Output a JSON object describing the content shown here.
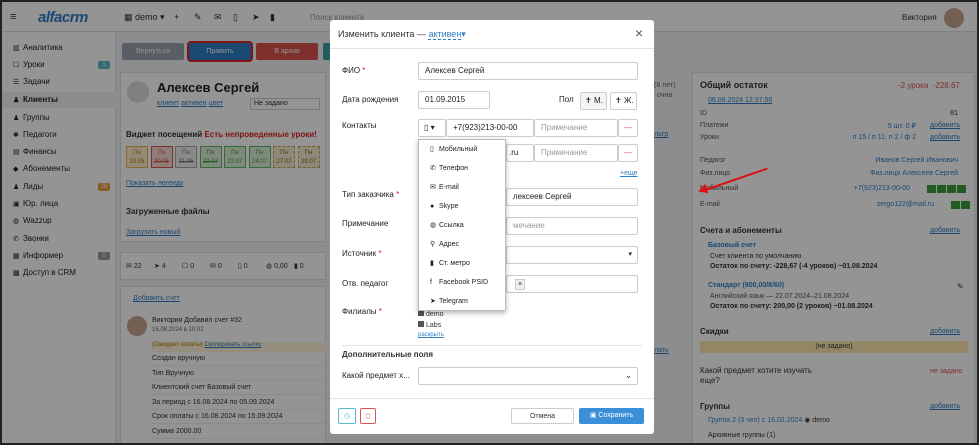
{
  "topbar": {
    "logo": "alfacrm",
    "branch": "demo",
    "search_placeholder": "Поиск клиента",
    "user_name": "Виктория"
  },
  "sidebar": {
    "items": [
      {
        "label": "Аналитика",
        "icon": "chart-icon"
      },
      {
        "label": "Уроки",
        "icon": "calendar-icon",
        "badge": "1"
      },
      {
        "label": "Задачи",
        "icon": "tasks-icon"
      },
      {
        "label": "Клиенты",
        "icon": "user-icon"
      },
      {
        "label": "Группы",
        "icon": "users-icon"
      },
      {
        "label": "Педагоги",
        "icon": "teacher-icon"
      },
      {
        "label": "Финансы",
        "icon": "finance-icon"
      },
      {
        "label": "Абонементы",
        "icon": "tag-icon"
      },
      {
        "label": "Лиды",
        "icon": "lead-icon",
        "badge": "26"
      },
      {
        "label": "Юр. лица",
        "icon": "building-icon"
      },
      {
        "label": "Wazzup",
        "icon": "chat-icon"
      },
      {
        "label": "Звонки",
        "icon": "phone-icon"
      },
      {
        "label": "Информер",
        "icon": "inbox-icon",
        "badge": "0"
      },
      {
        "label": "Доступ в CRM",
        "icon": "lock-icon"
      }
    ]
  },
  "client": {
    "toolbar": {
      "back": "Вернуться",
      "edit": "Править",
      "archive": "В архив"
    },
    "name": "Алексев Сергей",
    "tags": {
      "type": "клиент",
      "status": "активен",
      "color": "цвет",
      "select": "Не задано"
    },
    "widget_title": "Виджет посещений",
    "widget_warning": "Есть непроведенные уроки!",
    "visits": [
      {
        "day": "Пн",
        "date": "20.05"
      },
      {
        "day": "Пн",
        "date": "20.05"
      },
      {
        "day": "Пн",
        "date": "21.05"
      },
      {
        "day": "Пн",
        "date": "22.07"
      },
      {
        "day": "Пн",
        "date": "22.07"
      },
      {
        "day": "Пн",
        "date": "24.07"
      },
      {
        "day": "Пн",
        "date": "27.07"
      },
      {
        "day": "Пн",
        "date": "29.07"
      }
    ],
    "show_legend": "Показать легенду",
    "files_title": "Загруженные файлы",
    "upload": "Загрузить новый",
    "stats": [
      "22",
      "4",
      "0",
      "0",
      "0",
      "0,00",
      "0"
    ],
    "add_invoice": "Добавить счет",
    "feed_author": "Виктория Добавил счет #32",
    "feed_time": "16.08.2024 в 10:02",
    "feed_status": "(Ожидает оплаты)",
    "feed_copy": "Скопировать ссылку",
    "feed_rows": [
      "Создан вручную",
      "Тип Вручную",
      "Клиентский счет Базовый счет",
      "За период с 16.08.2024 по 05.09.2024",
      "Срок оплаты с 16.08.2024 по 15.09.2024",
      "Сумма 2000.00"
    ],
    "side_bits": [
      "(8 лет)",
      "очна",
      "льтр",
      "лать"
    ]
  },
  "right_panel": {
    "balance_title": "Общий остаток",
    "balance_lessons": "-2 урока",
    "balance_amount": "-228,67",
    "date": "06.08.2024 12:37:56",
    "rows": [
      {
        "label": "ID",
        "value": "81"
      },
      {
        "label": "Платежи",
        "value": "5 шт. 0 ₽",
        "action": "добавить"
      },
      {
        "label": "Уроки",
        "value": "п 15 / п 11, п 2 / ф 2",
        "action": "добавить"
      },
      {
        "label": "Педагог",
        "value": "Иванов Сергей Иванович"
      },
      {
        "label": "Физ.лицо",
        "value": "Физ.лицо Алексеев Сергей"
      },
      {
        "label": "Мобильный",
        "value": "+7(923)213-00-00"
      },
      {
        "label": "E-mail",
        "value": "sergo122@mail.ru"
      }
    ],
    "accounts_title": "Счета и абонементы",
    "accounts_add": "добавить",
    "base_account": "Базовый счет",
    "base_desc": "Счет клиента по умолчанию",
    "base_balance": "Остаток по счету: -228,67 (-4 уроков) ~01.08.2024",
    "standard": "Стандарт (800,00/8/60)",
    "standard_desc": "Английский язык — 22.07.2024–21.08.2024",
    "standard_balance": "Остаток по счету: 200,00 (2 уроков) ~01.08.2024",
    "discounts_title": "Скидки",
    "discounts_add": "добавить",
    "discounts_value": "(не задано)",
    "question": "Какой предмет хотите изучать еще?",
    "question_value": "не задано",
    "groups_title": "Группы",
    "groups_add": "добавить",
    "group_item": "Группа 2 (3 чел) с 16.02.2024",
    "group_branch": "demo",
    "archive_groups": "Архивные группы (1)"
  },
  "modal": {
    "title": "Изменить клиента",
    "status": "активен",
    "fio_label": "ФИО",
    "fio_value": "Алексев Сергей",
    "birth_label": "Дата рождения",
    "birth_value": "01.09.2015",
    "gender_label": "Пол",
    "gender_m": "М.",
    "gender_f": "Ж.",
    "contacts_label": "Контакты",
    "phone_value": "+7(923)213-00-00",
    "note_placeholder": "Примечание",
    "email_partial": ".ru",
    "more": "+еще",
    "customer_type_label": "Тип заказчика",
    "customer_value": "лексеев Сергей",
    "note_label": "Примечание",
    "note_field_placeholder": "мечание",
    "source_label": "Источник",
    "teacher_label": "Отв. педагог",
    "branches_label": "Филиалы",
    "branch_1": "demo",
    "branch_2": "Labs",
    "expand": "раскрыть",
    "extra_title": "Дополнительные поля",
    "subject_label": "Какой предмет х...",
    "cancel": "Отмена",
    "save": "Сохранить"
  },
  "dropdown": {
    "items": [
      {
        "label": "Мобильный",
        "icon": "mobile-icon"
      },
      {
        "label": "Телефон",
        "icon": "phone-icon"
      },
      {
        "label": "E-mail",
        "icon": "email-icon"
      },
      {
        "label": "Skype",
        "icon": "skype-icon"
      },
      {
        "label": "Ссылка",
        "icon": "globe-icon"
      },
      {
        "label": "Адрес",
        "icon": "location-icon"
      },
      {
        "label": "Ст. метро",
        "icon": "metro-icon"
      },
      {
        "label": "Facebook PSID",
        "icon": "facebook-icon"
      },
      {
        "label": "Telegram",
        "icon": "telegram-icon"
      }
    ]
  },
  "colors": {
    "accent": "#2c7fc7",
    "danger": "#d9534f",
    "success": "#3c9b3c",
    "warning": "#e8a33c",
    "overlay": "rgba(0,0,0,0.42)"
  }
}
